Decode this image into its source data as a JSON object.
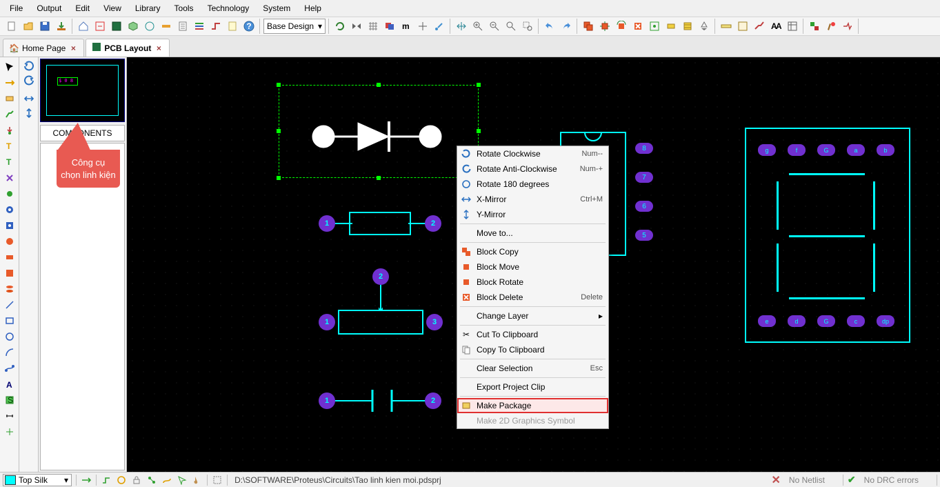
{
  "menu": {
    "items": [
      "File",
      "Output",
      "Edit",
      "View",
      "Library",
      "Tools",
      "Technology",
      "System",
      "Help"
    ]
  },
  "toolbar": {
    "design_combo": "Base Design"
  },
  "tabs": {
    "home": "Home Page",
    "pcb": "PCB Layout"
  },
  "side": {
    "components_header": "COMPONENTS",
    "overview_label": "$ 0 8"
  },
  "callout": {
    "text": "Công cụ chọn linh kiện"
  },
  "ctx": {
    "rotate_cw": "Rotate Clockwise",
    "rotate_cw_key": "Num--",
    "rotate_acw": "Rotate Anti-Clockwise",
    "rotate_acw_key": "Num-+",
    "rotate_180": "Rotate 180 degrees",
    "x_mirror": "X-Mirror",
    "x_mirror_key": "Ctrl+M",
    "y_mirror": "Y-Mirror",
    "move_to": "Move to...",
    "blk_copy": "Block Copy",
    "blk_move": "Block Move",
    "blk_rotate": "Block Rotate",
    "blk_delete": "Block Delete",
    "blk_delete_key": "Delete",
    "change_layer": "Change Layer",
    "cut": "Cut To Clipboard",
    "copy": "Copy To Clipboard",
    "clear_sel": "Clear Selection",
    "clear_sel_key": "Esc",
    "export_clip": "Export Project Clip",
    "make_pkg": "Make Package",
    "make_2d": "Make 2D Graphics Symbol"
  },
  "seven_seg": {
    "top": [
      "g",
      "f",
      "G",
      "a",
      "b"
    ],
    "bottom": [
      "e",
      "d",
      "G",
      "c",
      "dp"
    ]
  },
  "ic_pads": {
    "right": [
      "8",
      "7",
      "6",
      "5"
    ]
  },
  "status": {
    "layer": "Top Silk",
    "path": "D:\\SOFTWARE\\Proteus\\Circuits\\Tao linh kien moi.pdsprj",
    "netlist": "No Netlist",
    "drc": "No DRC errors"
  },
  "comp_pads": {
    "r": [
      "1",
      "2"
    ],
    "pot": [
      "1",
      "2",
      "3"
    ],
    "cap": [
      "1",
      "2"
    ]
  }
}
